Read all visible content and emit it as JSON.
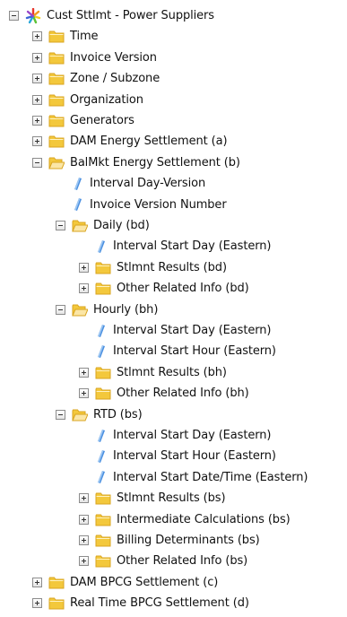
{
  "tree": [
    {
      "label": "Cust Sttlmt - Power Suppliers",
      "level": 0,
      "kind": "root",
      "toggle": "minus"
    },
    {
      "label": "Time",
      "level": 1,
      "kind": "folder",
      "toggle": "plus"
    },
    {
      "label": "Invoice Version",
      "level": 1,
      "kind": "folder",
      "toggle": "plus"
    },
    {
      "label": "Zone / Subzone",
      "level": 1,
      "kind": "folder",
      "toggle": "plus"
    },
    {
      "label": "Organization",
      "level": 1,
      "kind": "folder",
      "toggle": "plus"
    },
    {
      "label": "Generators",
      "level": 1,
      "kind": "folder",
      "toggle": "plus"
    },
    {
      "label": "DAM Energy Settlement (a)",
      "level": 1,
      "kind": "folder",
      "toggle": "plus"
    },
    {
      "label": "BalMkt Energy Settlement (b)",
      "level": 1,
      "kind": "folder-open",
      "toggle": "minus"
    },
    {
      "label": "Interval Day-Version",
      "level": 2,
      "kind": "leaf",
      "toggle": "none"
    },
    {
      "label": "Invoice Version Number",
      "level": 2,
      "kind": "leaf",
      "toggle": "none"
    },
    {
      "label": "Daily (bd)",
      "level": 2,
      "kind": "folder-open",
      "toggle": "minus"
    },
    {
      "label": "Interval Start Day (Eastern)",
      "level": 3,
      "kind": "leaf",
      "toggle": "none"
    },
    {
      "label": "Stlmnt Results (bd)",
      "level": 3,
      "kind": "folder",
      "toggle": "plus"
    },
    {
      "label": "Other Related Info (bd)",
      "level": 3,
      "kind": "folder",
      "toggle": "plus"
    },
    {
      "label": "Hourly (bh)",
      "level": 2,
      "kind": "folder-open",
      "toggle": "minus"
    },
    {
      "label": "Interval Start Day (Eastern)",
      "level": 3,
      "kind": "leaf",
      "toggle": "none"
    },
    {
      "label": "Interval Start Hour (Eastern)",
      "level": 3,
      "kind": "leaf",
      "toggle": "none"
    },
    {
      "label": "Stlmnt Results (bh)",
      "level": 3,
      "kind": "folder",
      "toggle": "plus"
    },
    {
      "label": "Other Related Info (bh)",
      "level": 3,
      "kind": "folder",
      "toggle": "plus"
    },
    {
      "label": "RTD (bs)",
      "level": 2,
      "kind": "folder-open",
      "toggle": "minus"
    },
    {
      "label": "Interval Start Day (Eastern)",
      "level": 3,
      "kind": "leaf",
      "toggle": "none"
    },
    {
      "label": "Interval Start Hour (Eastern)",
      "level": 3,
      "kind": "leaf",
      "toggle": "none"
    },
    {
      "label": "Interval Start Date/Time (Eastern)",
      "level": 3,
      "kind": "leaf",
      "toggle": "none"
    },
    {
      "label": "Stlmnt Results (bs)",
      "level": 3,
      "kind": "folder",
      "toggle": "plus"
    },
    {
      "label": "Intermediate Calculations (bs)",
      "level": 3,
      "kind": "folder",
      "toggle": "plus"
    },
    {
      "label": "Billing Determinants (bs)",
      "level": 3,
      "kind": "folder",
      "toggle": "plus"
    },
    {
      "label": "Other Related Info (bs)",
      "level": 3,
      "kind": "folder",
      "toggle": "plus"
    },
    {
      "label": "DAM BPCG Settlement (c)",
      "level": 1,
      "kind": "folder",
      "toggle": "plus"
    },
    {
      "label": "Real Time BPCG Settlement (d)",
      "level": 1,
      "kind": "folder",
      "toggle": "plus"
    }
  ],
  "colors": {
    "folder": "#f3c83c",
    "folder_dark": "#d9a520",
    "folder_open_front": "#fbe6a6",
    "leaf": "#4a8fe0",
    "leaf_light": "#9cc6f2"
  }
}
